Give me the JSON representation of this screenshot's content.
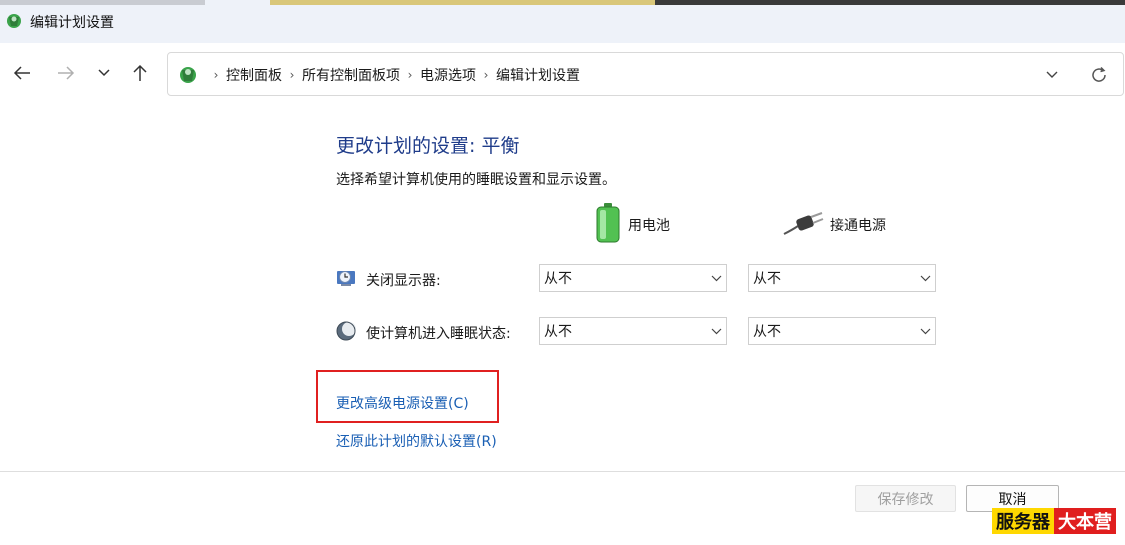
{
  "window": {
    "title": "编辑计划设置"
  },
  "address": {
    "breadcrumbs": [
      "控制面板",
      "所有控制面板项",
      "电源选项",
      "编辑计划设置"
    ]
  },
  "content": {
    "title": "更改计划的设置: 平衡",
    "subtitle": "选择希望计算机使用的睡眠设置和显示设置。",
    "columns": {
      "battery": "用电池",
      "plugged_in": "接通电源"
    },
    "rows": [
      {
        "label": "关闭显示器:",
        "battery_value": "从不",
        "plugged_value": "从不"
      },
      {
        "label": "使计算机进入睡眠状态:",
        "battery_value": "从不",
        "plugged_value": "从不"
      }
    ],
    "links": {
      "advanced": "更改高级电源设置(C)",
      "restore": "还原此计划的默认设置(R)"
    }
  },
  "footer": {
    "save_label": "保存修改",
    "cancel_label": "取消"
  },
  "watermark": {
    "part1": "服务器",
    "part2": "大本营"
  },
  "colors": {
    "title_blue": "#1f3c8a",
    "link_blue": "#1a5fb4",
    "highlight_red": "#e02020",
    "titlebar_bg": "#eef2f9"
  },
  "icons": {
    "app": "control-panel-icon",
    "back": "arrow-left-icon",
    "forward": "arrow-right-icon",
    "recent": "chevron-down-icon",
    "up": "arrow-up-icon",
    "refresh": "refresh-icon",
    "battery": "battery-icon",
    "plug": "power-plug-icon",
    "display": "display-clock-icon",
    "sleep": "moon-icon"
  }
}
